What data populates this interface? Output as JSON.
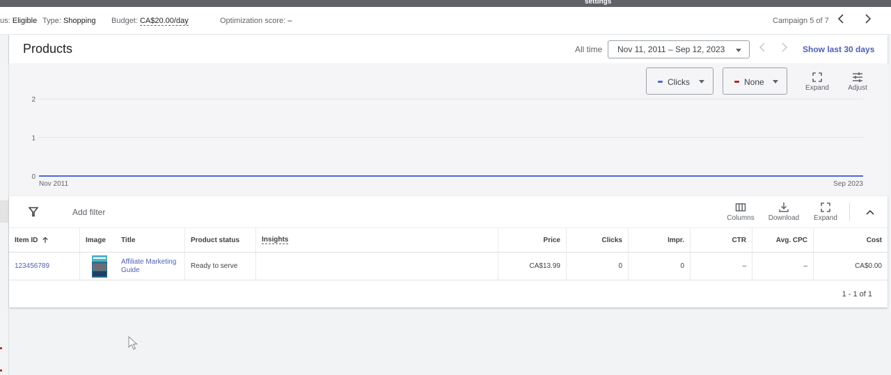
{
  "topbar": {
    "title": "settings"
  },
  "status_bar": {
    "status_label": "us:",
    "status_value": "Eligible",
    "type_label": "Type:",
    "type_value": "Shopping",
    "budget_label": "Budget:",
    "budget_value": "CA$20.00/day",
    "opt_label": "Optimization score:",
    "opt_value": "–",
    "campaign_nav": "Campaign 5 of 7"
  },
  "header": {
    "title": "Products",
    "date_label": "All time",
    "date_range": "Nov 11, 2011 – Sep 12, 2023",
    "show_last_30": "Show last 30 days"
  },
  "chart_controls": {
    "metric1": {
      "label": "Clicks",
      "color": "#4a6ad4"
    },
    "metric2": {
      "label": "None",
      "color": "#b3261e"
    },
    "expand_label": "Expand",
    "adjust_label": "Adjust"
  },
  "chart_data": {
    "type": "line",
    "title": "",
    "xlabel": "",
    "ylabel": "",
    "x_tick_labels": [
      "Nov 2011",
      "Sep 2023"
    ],
    "y_ticks": [
      0,
      1,
      2
    ],
    "ylim": [
      0,
      2
    ],
    "grid": true,
    "series": [
      {
        "name": "Clicks",
        "color": "#4a6ad4",
        "x": [
          "Nov 2011",
          "Sep 2023"
        ],
        "values": [
          0,
          0
        ]
      }
    ]
  },
  "table_toolbar": {
    "add_filter": "Add filter",
    "columns_label": "Columns",
    "download_label": "Download",
    "expand_label": "Expand"
  },
  "table": {
    "headers": {
      "item_id": "Item ID",
      "image": "Image",
      "title": "Title",
      "product_status": "Product status",
      "insights": "Insights",
      "price": "Price",
      "clicks": "Clicks",
      "impr": "Impr.",
      "ctr": "CTR",
      "avg_cpc": "Avg. CPC",
      "cost": "Cost"
    },
    "rows": [
      {
        "item_id": "123456789",
        "title": "Affiliate Marketing Guide",
        "product_status": "Ready to serve",
        "insights": "",
        "price": "CA$13.99",
        "clicks": "0",
        "impr": "0",
        "ctr": "–",
        "avg_cpc": "–",
        "cost": "CA$0.00"
      }
    ],
    "pagination": "1 - 1 of 1"
  }
}
